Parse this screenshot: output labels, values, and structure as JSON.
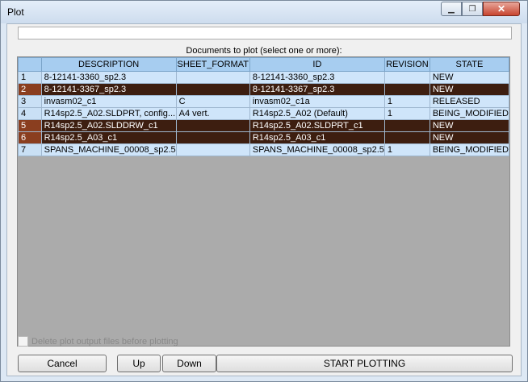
{
  "window": {
    "title": "Plot"
  },
  "titlebar": {
    "minimize": "▁",
    "maximize": "❐",
    "close": "✕"
  },
  "documents_label": "Documents to plot (select one or more):",
  "columns": [
    "DESCRIPTION",
    "SHEET_FORMAT",
    "ID",
    "REVISION",
    "STATE"
  ],
  "rows": [
    {
      "num": "1",
      "description": "8-12141-3360_sp2.3",
      "sheet_format": "",
      "id": "8-12141-3360_sp2.3",
      "revision": "",
      "state": "NEW",
      "selected": false
    },
    {
      "num": "2",
      "description": "8-12141-3367_sp2.3",
      "sheet_format": "",
      "id": "8-12141-3367_sp2.3",
      "revision": "",
      "state": "NEW",
      "selected": true
    },
    {
      "num": "3",
      "description": "invasm02_c1",
      "sheet_format": "C",
      "id": "invasm02_c1a",
      "revision": "1",
      "state": "RELEASED",
      "selected": false
    },
    {
      "num": "4",
      "description": "R14sp2.5_A02.SLDPRT, config...",
      "sheet_format": "A4 vert.",
      "id": "R14sp2.5_A02 (Default)",
      "revision": "1",
      "state": "BEING_MODIFIED",
      "selected": false
    },
    {
      "num": "5",
      "description": "R14sp2.5_A02.SLDDRW_c1",
      "sheet_format": "",
      "id": "R14sp2.5_A02.SLDPRT_c1",
      "revision": "",
      "state": "NEW",
      "selected": true
    },
    {
      "num": "6",
      "description": "R14sp2.5_A03_c1",
      "sheet_format": "",
      "id": "R14sp2.5_A03_c1",
      "revision": "",
      "state": "NEW",
      "selected": true
    },
    {
      "num": "7",
      "description": "SPANS_MACHINE_00008_sp2.5",
      "sheet_format": "",
      "id": "SPANS_MACHINE_00008_sp2.5",
      "revision": "1",
      "state": "BEING_MODIFIED",
      "selected": false
    }
  ],
  "delete_option": {
    "label": "Delete plot output files before plotting",
    "checked": false
  },
  "buttons": {
    "cancel": "Cancel",
    "up": "Up",
    "down": "Down",
    "start": "START PLOTTING"
  },
  "colors": {
    "selected_row": "#3d1e10",
    "header": "#a7cdf0",
    "row": "#cfe5fa"
  }
}
